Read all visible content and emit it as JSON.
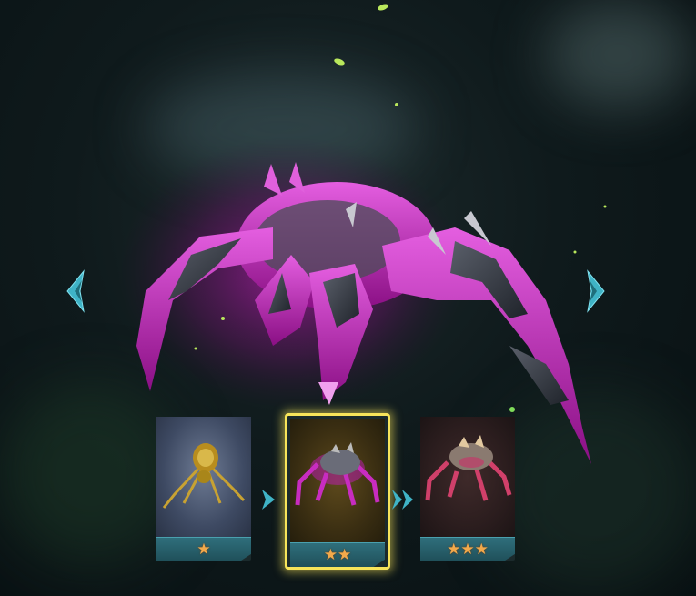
{
  "navigation": {
    "prev_icon": "chevron-left-icon",
    "next_icon": "chevron-right-icon"
  },
  "evolution": {
    "stages": [
      {
        "stars": "★",
        "star_count": 1,
        "selected": false
      },
      {
        "stars": "★★",
        "star_count": 2,
        "selected": true
      },
      {
        "stars": "★★★",
        "star_count": 3,
        "selected": false
      }
    ],
    "arrow_1_icon": "single-chevron-right-icon",
    "arrow_2_icon": "double-chevron-right-icon"
  },
  "colors": {
    "accent_cyan": "#3fb3c6",
    "selection_yellow": "#f7e45a",
    "creature_magenta": "#d21ec8",
    "star_orange": "#f3a94b"
  }
}
